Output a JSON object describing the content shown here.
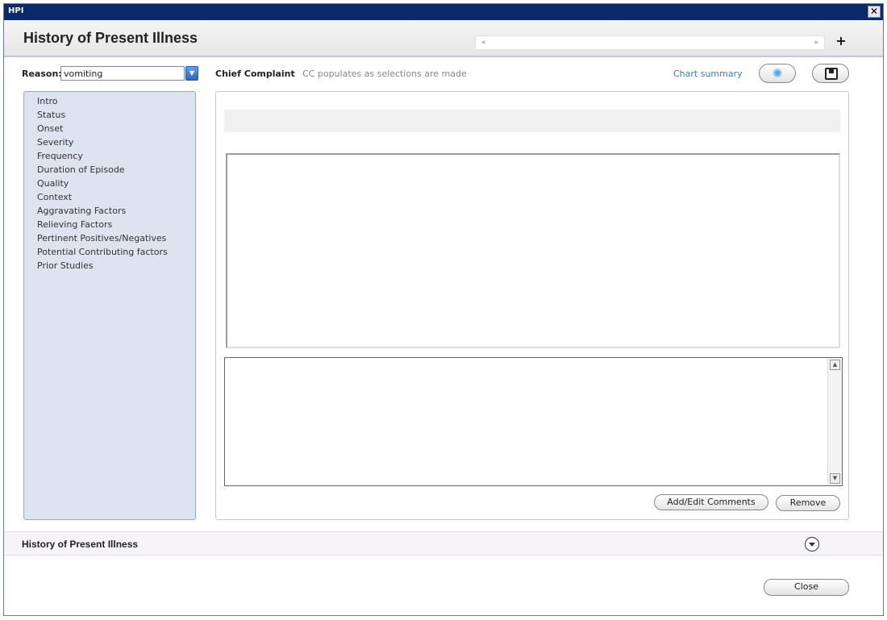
{
  "window": {
    "title": "HPI",
    "close_glyph": "✕"
  },
  "header": {
    "title": "History of Present Illness",
    "nav_left_glyph": "◂",
    "nav_right_glyph": "▸",
    "add_glyph": "+"
  },
  "reason": {
    "label": "Reason:",
    "value": "vomiting",
    "dropdown_glyph": "▼"
  },
  "chief_complaint": {
    "label": "Chief Complaint",
    "hint": "CC populates as selections are made"
  },
  "toolbar": {
    "chart_summary": "Chart summary",
    "refresh_icon": "refresh-icon",
    "refresh_glyph": "✺",
    "save_icon": "floppy-disk-icon"
  },
  "sidebar": {
    "items": [
      {
        "label": "Intro"
      },
      {
        "label": "Status"
      },
      {
        "label": "Onset"
      },
      {
        "label": "Severity"
      },
      {
        "label": "Frequency"
      },
      {
        "label": "Duration of Episode"
      },
      {
        "label": "Quality"
      },
      {
        "label": "Context"
      },
      {
        "label": "Aggravating Factors"
      },
      {
        "label": "Relieving Factors"
      },
      {
        "label": "Pertinent Positives/Negatives"
      },
      {
        "label": "Potential Contributing factors"
      },
      {
        "label": "Prior Studies"
      }
    ]
  },
  "comments": {
    "scroll_up_glyph": "▲",
    "scroll_down_glyph": "▼",
    "add_edit_label": "Add/Edit Comments",
    "remove_label": "Remove"
  },
  "section": {
    "title": "History of Present Illness"
  },
  "footer": {
    "close_label": "Close"
  }
}
